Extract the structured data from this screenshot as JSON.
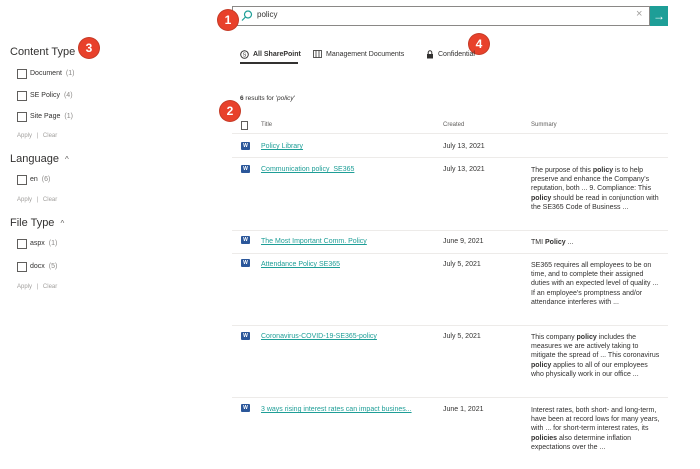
{
  "search": {
    "query": "policy",
    "clear": "×",
    "go": "→"
  },
  "badges": {
    "b1": "1",
    "b2": "2",
    "b3": "3",
    "b4": "4"
  },
  "refiners": {
    "content_type": {
      "title": "Content Type",
      "items": [
        {
          "label": "Document",
          "count": "(1)"
        },
        {
          "label": "SE Policy",
          "count": "(4)"
        },
        {
          "label": "Site Page",
          "count": "(1)"
        }
      ],
      "apply": "Apply",
      "clear": "Clear",
      "sep": "|"
    },
    "language": {
      "title": "Language",
      "chevron": "^",
      "items": [
        {
          "label": "en",
          "count": "(6)"
        }
      ],
      "apply": "Apply",
      "clear": "Clear",
      "sep": "|"
    },
    "file_type": {
      "title": "File Type",
      "chevron": "^",
      "items": [
        {
          "label": "aspx",
          "count": "(1)"
        },
        {
          "label": "docx",
          "count": "(5)"
        }
      ],
      "apply": "Apply",
      "clear": "Clear",
      "sep": "|"
    }
  },
  "tabs": [
    {
      "label": "All SharePoint",
      "icon": "sharepoint-icon"
    },
    {
      "label": "Management Documents",
      "icon": "library-icon"
    },
    {
      "label": "Confidential",
      "icon": "lock-icon"
    }
  ],
  "results": {
    "count_number": "6",
    "count_text": " results for '",
    "count_query": "policy",
    "count_end": "'",
    "headers": {
      "title": "Title",
      "created": "Created",
      "summary": "Summary"
    },
    "rows": [
      {
        "title": "Policy Library",
        "created": "July 13, 2021",
        "summary": ""
      },
      {
        "title": "Communication policy_SE365",
        "created": "July 13, 2021",
        "summary": "The purpose of this policy is to help preserve and enhance the Company's reputation, both ... 9. Compliance: This policy should be read in conjunction with the SE365 Code of Business ..."
      },
      {
        "title": "The Most Important Comm. Policy",
        "created": "June 9, 2021",
        "summary": "TMI Policy ..."
      },
      {
        "title": "Attendance Policy SE365",
        "created": "July 5, 2021",
        "summary": "SE365 requires all employees to be on time, and to complete their assigned duties with an expected level of quality ... If an employee's promptness and/or attendance interferes with ..."
      },
      {
        "title": "Coronavirus-COVID-19-SE365-policy",
        "created": "July 5, 2021",
        "summary": "This company policy includes the measures we are actively taking to mitigate the spread of ... This coronavirus policy applies to all of our employees who physically work in our office ..."
      },
      {
        "title": "3 ways rising interest rates can impact busines...",
        "created": "June 1, 2021",
        "summary": "Interest rates, both short- and long-term, have been at record lows for many years, with ... for short-term interest rates, its policies also determine inflation expectations over the ..."
      }
    ]
  },
  "colors": {
    "accent": "#1e9e97",
    "badge": "#e8412b",
    "word": "#2b579a"
  }
}
